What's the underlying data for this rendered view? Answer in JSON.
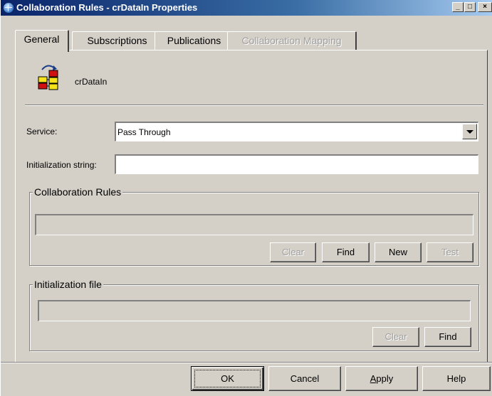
{
  "window": {
    "title": "Collaboration Rules - crDataIn Properties",
    "controls": {
      "minimize": "_",
      "maximize": "□",
      "close": "×"
    }
  },
  "tabs": [
    {
      "label": "General",
      "active": true,
      "enabled": true
    },
    {
      "label": "Subscriptions",
      "active": false,
      "enabled": true
    },
    {
      "label": "Publications",
      "active": false,
      "enabled": true
    },
    {
      "label": "Collaboration Mapping",
      "active": false,
      "enabled": false
    }
  ],
  "general": {
    "collaboration_icon": "collaboration-components-icon",
    "name": "crDataIn",
    "service": {
      "label": "Service:",
      "value": "Pass Through"
    },
    "init_string": {
      "label": "Initialization string:",
      "value": ""
    },
    "collab_rules_group": {
      "label": "Collaboration Rules",
      "value": "",
      "buttons": {
        "clear": "Clear",
        "find": "Find",
        "new": "New",
        "test": "Test"
      }
    },
    "init_file_group": {
      "label": "Initialization file",
      "value": "",
      "buttons": {
        "clear": "Clear",
        "find": "Find"
      }
    }
  },
  "footer": {
    "ok": "OK",
    "cancel": "Cancel",
    "apply_underlined": "A",
    "apply_rest": "pply",
    "help": "Help"
  },
  "colors": {
    "face": "#d4d0c8",
    "titlebar_start": "#0a246a",
    "titlebar_end": "#a6caf0",
    "disabled_text": "#a0a0a0"
  }
}
